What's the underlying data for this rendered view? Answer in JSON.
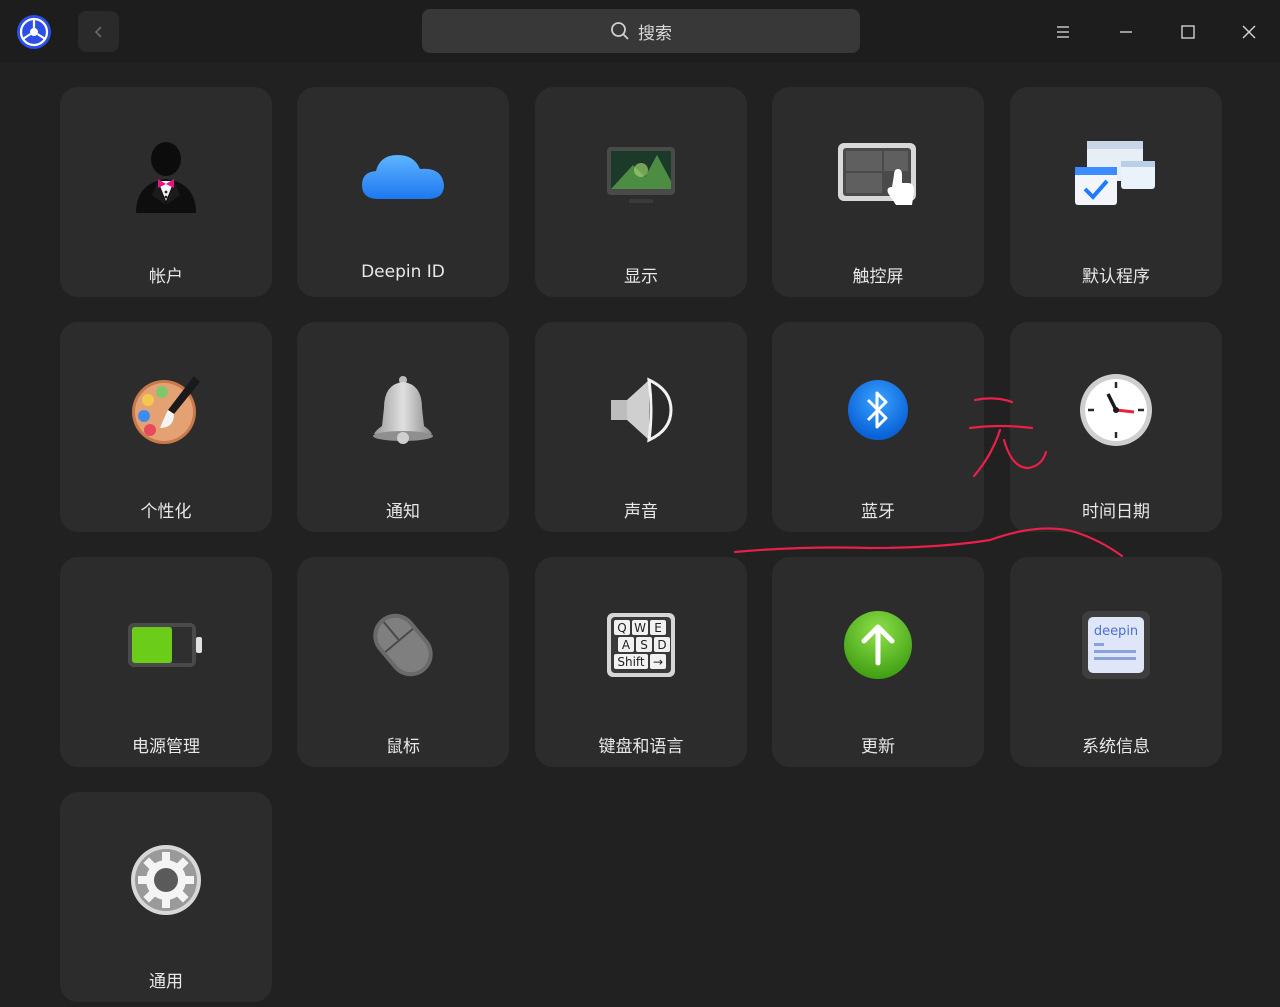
{
  "titlebar": {
    "search_placeholder": "搜索",
    "icons": {
      "logo": "deepin-settings-logo",
      "back": "chevron-left-icon",
      "search": "search-icon",
      "menu": "menu-icon",
      "minimize": "minimize-icon",
      "maximize": "maximize-icon",
      "close": "close-icon"
    }
  },
  "modules": [
    {
      "label": "帐户",
      "icon": "account-icon"
    },
    {
      "label": "Deepin ID",
      "icon": "cloud-icon"
    },
    {
      "label": "显示",
      "icon": "display-icon"
    },
    {
      "label": "触控屏",
      "icon": "touchscreen-icon"
    },
    {
      "label": "默认程序",
      "icon": "default-apps-icon"
    },
    {
      "label": "个性化",
      "icon": "palette-icon"
    },
    {
      "label": "通知",
      "icon": "bell-icon"
    },
    {
      "label": "声音",
      "icon": "speaker-icon"
    },
    {
      "label": "蓝牙",
      "icon": "bluetooth-icon"
    },
    {
      "label": "时间日期",
      "icon": "clock-icon"
    },
    {
      "label": "电源管理",
      "icon": "battery-icon"
    },
    {
      "label": "鼠标",
      "icon": "mouse-icon"
    },
    {
      "label": "键盘和语言",
      "icon": "keyboard-icon"
    },
    {
      "label": "更新",
      "icon": "update-icon"
    },
    {
      "label": "系统信息",
      "icon": "system-info-icon"
    },
    {
      "label": "通用",
      "icon": "gear-icon"
    }
  ],
  "icon_text": {
    "keyboard_keys": [
      "Q",
      "W",
      "E",
      "A",
      "S",
      "D",
      "Shift",
      "→"
    ],
    "system_info_brand": "deepin"
  },
  "annotation": {
    "handwritten_text": "无",
    "color": "#e8204a"
  },
  "colors": {
    "background": "#212121",
    "titlebar": "#1d1d1d",
    "tile": "#2c2c2c",
    "accent_blue": "#1e7cff"
  }
}
